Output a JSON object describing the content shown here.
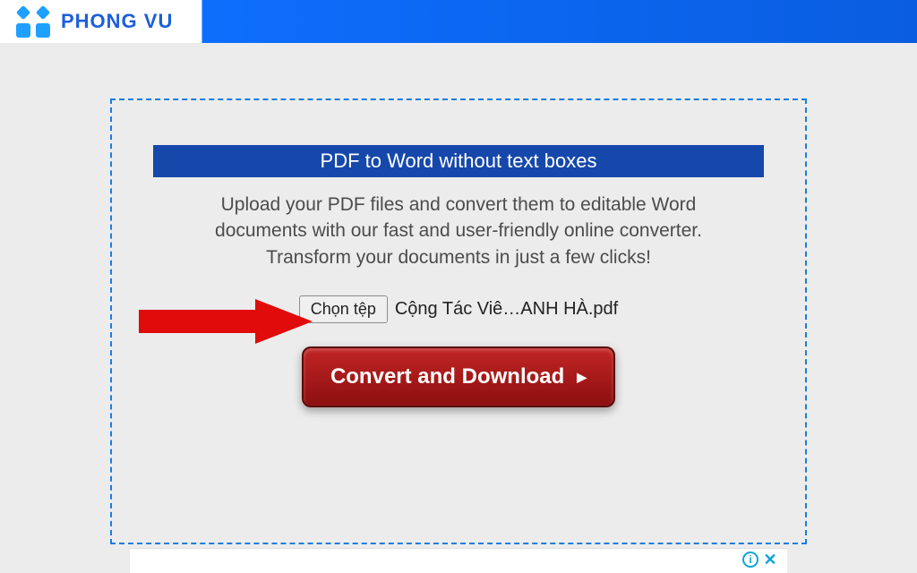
{
  "header": {
    "logo_text": "PHONG VU"
  },
  "main": {
    "title": "PDF to Word without text boxes",
    "description": "Upload your PDF files and convert them to editable Word documents with our fast and user-friendly online converter. Transform your documents in just a few clicks!",
    "file_picker_label": "Chọn tệp",
    "selected_filename": "Cộng Tác Viê…ANH HÀ.pdf",
    "convert_button_label": "Convert and Download"
  },
  "ad": {
    "info_glyph": "i",
    "close_glyph": "✕"
  }
}
